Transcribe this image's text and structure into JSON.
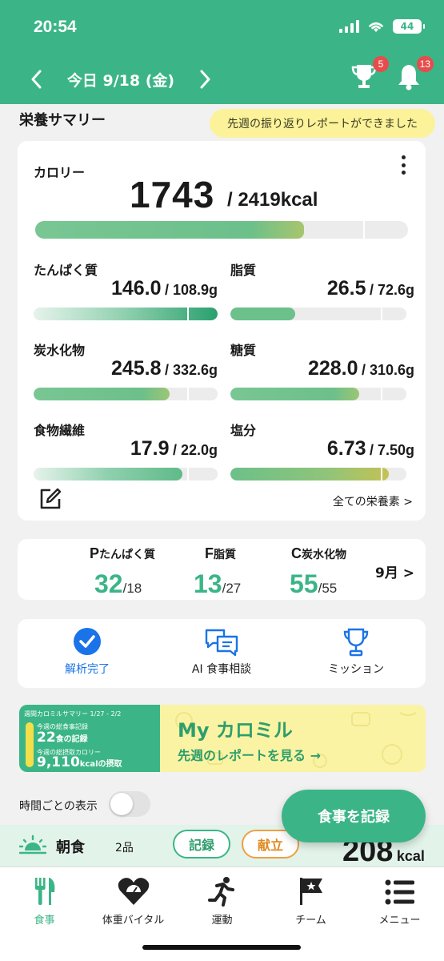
{
  "status_bar": {
    "time": "20:54",
    "battery": "44"
  },
  "header": {
    "date": "今日 9/18 (金)",
    "trophy_badge": "5",
    "bell_badge": "13"
  },
  "summary": {
    "title": "栄養サマリー",
    "notice": "先週の振り返りレポートができました"
  },
  "calorie": {
    "label": "カロリー",
    "value": "1743",
    "target": "/ 2419kcal",
    "progress": 0.72
  },
  "nutrients": [
    {
      "name": "たんぱく質",
      "value": "146.0",
      "target": "/ 108.9g",
      "progress": 1.0
    },
    {
      "name": "脂質",
      "value": "26.5",
      "target": "/ 72.6g",
      "progress": 0.37
    },
    {
      "name": "炭水化物",
      "value": "245.8",
      "target": "/ 332.6g",
      "progress": 0.74
    },
    {
      "name": "糖質",
      "value": "228.0",
      "target": "/ 310.6g",
      "progress": 0.73
    },
    {
      "name": "食物繊維",
      "value": "17.9",
      "target": "/ 22.0g",
      "progress": 0.81
    },
    {
      "name": "塩分",
      "value": "6.73",
      "target": "/ 7.50g",
      "progress": 0.9
    }
  ],
  "all_nutrients_link": "全ての栄養素 >",
  "pfc": {
    "p": {
      "letter": "P",
      "name": "たんぱく質",
      "value": "32",
      "target": "/18"
    },
    "f": {
      "letter": "F",
      "name": "脂質",
      "value": "13",
      "target": "/27"
    },
    "c": {
      "letter": "C",
      "name": "炭水化物",
      "value": "55",
      "target": "/55"
    },
    "month_link": "9月 >"
  },
  "actions": [
    {
      "label": "解析完了"
    },
    {
      "label": "AI 食事相談"
    },
    {
      "label": "ミッション"
    }
  ],
  "banner": {
    "header": "週間カロミルサマリー 1/27 - 2/2",
    "line1_caption": "今週の総食事記録",
    "line1_value": "22",
    "line1_unit": "食の記録",
    "line2_caption": "今週の総摂取カロリー",
    "line2_value": "9,110",
    "line2_unit": "kcalの摂取",
    "brand": "My カロミル",
    "cta": "先週のレポートを見る →"
  },
  "hourly": {
    "label": "時間ごとの表示"
  },
  "fab": {
    "label": "食事を記録"
  },
  "meal": {
    "name": "朝食",
    "count": "2品",
    "record": "記録",
    "menu": "献立",
    "kcal": "208",
    "kcal_unit": "kcal"
  },
  "tabs": [
    {
      "label": "食事"
    },
    {
      "label": "体重バイタル"
    },
    {
      "label": "運動"
    },
    {
      "label": "チーム"
    },
    {
      "label": "メニュー"
    }
  ],
  "colors": {
    "brand": "#3bb587",
    "badge": "#e74c4c",
    "notice": "#fbf29a",
    "menu_pill": "#f0a040"
  }
}
